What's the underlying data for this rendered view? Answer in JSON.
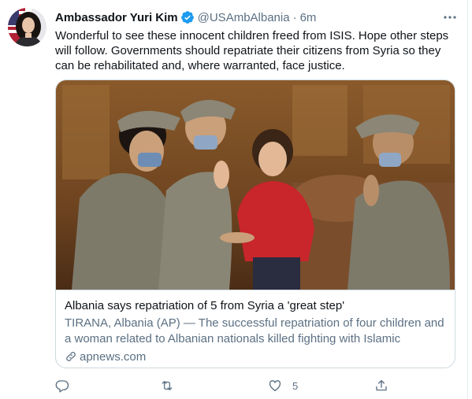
{
  "tweet": {
    "display_name": "Ambassador Yuri Kim",
    "handle": "@USAmbAlbania",
    "separator": "·",
    "time": "6m",
    "verified_icon": "verified-badge-icon",
    "text": "Wonderful to see these innocent children freed from ISIS. Hope other steps will follow. Governments should repatriate their citizens from Syria so they can be rehabilitated and, where warranted, face justice."
  },
  "card": {
    "title": "Albania says repatriation of 5 from Syria a 'great step'",
    "description": "TIRANA, Albania (AP) — The successful repatriation of four children and a woman related to Albanian nationals killed fighting with Islamic extremi…",
    "domain": "apnews.com",
    "image_description": "photo"
  },
  "actions": {
    "reply_icon": "reply-icon",
    "retweet_icon": "retweet-icon",
    "like_icon": "heart-icon",
    "like_count": "5",
    "share_icon": "share-icon"
  },
  "colors": {
    "text": "#0f1419",
    "secondary": "#5b7083",
    "verified": "#1d9bf0",
    "border": "#cfd9de"
  }
}
